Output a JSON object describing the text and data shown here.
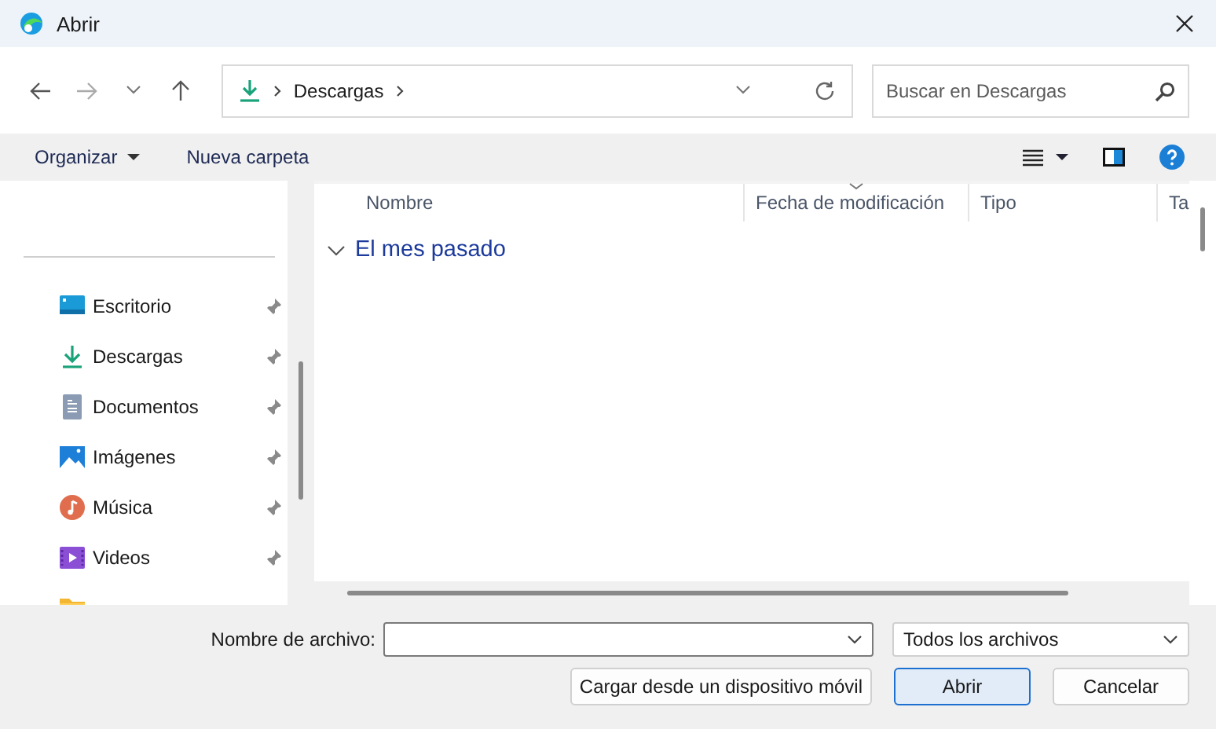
{
  "window": {
    "title": "Abrir"
  },
  "address": {
    "segments": [
      "Descargas"
    ]
  },
  "search": {
    "placeholder": "Buscar en Descargas"
  },
  "toolbar": {
    "organize": "Organizar",
    "new_folder": "Nueva carpeta"
  },
  "sidebar": {
    "items": [
      {
        "label": "Escritorio",
        "kind": "desktop",
        "pinned": true
      },
      {
        "label": "Descargas",
        "kind": "downloads",
        "pinned": true
      },
      {
        "label": "Documentos",
        "kind": "documents",
        "pinned": true
      },
      {
        "label": "Imágenes",
        "kind": "pictures",
        "pinned": true
      },
      {
        "label": "Música",
        "kind": "music",
        "pinned": true
      },
      {
        "label": "Videos",
        "kind": "videos",
        "pinned": true
      },
      {
        "kind": "folder",
        "pinned": false
      }
    ]
  },
  "file_list": {
    "columns": [
      {
        "label": "Nombre",
        "sorted": false
      },
      {
        "label": "Fecha de modificación",
        "sorted": true
      },
      {
        "label": "Tipo",
        "sorted": false
      },
      {
        "label": "Ta",
        "sorted": false
      }
    ],
    "groups": [
      {
        "label": "El mes pasado",
        "expanded": true
      }
    ]
  },
  "footer": {
    "filename_label": "Nombre de archivo:",
    "filter": "Todos los archivos",
    "buttons": [
      {
        "label": "Cargar desde un dispositivo móvil",
        "default": false
      },
      {
        "label": "Abrir",
        "default": true
      },
      {
        "label": "Cancelar",
        "default": false
      }
    ]
  }
}
